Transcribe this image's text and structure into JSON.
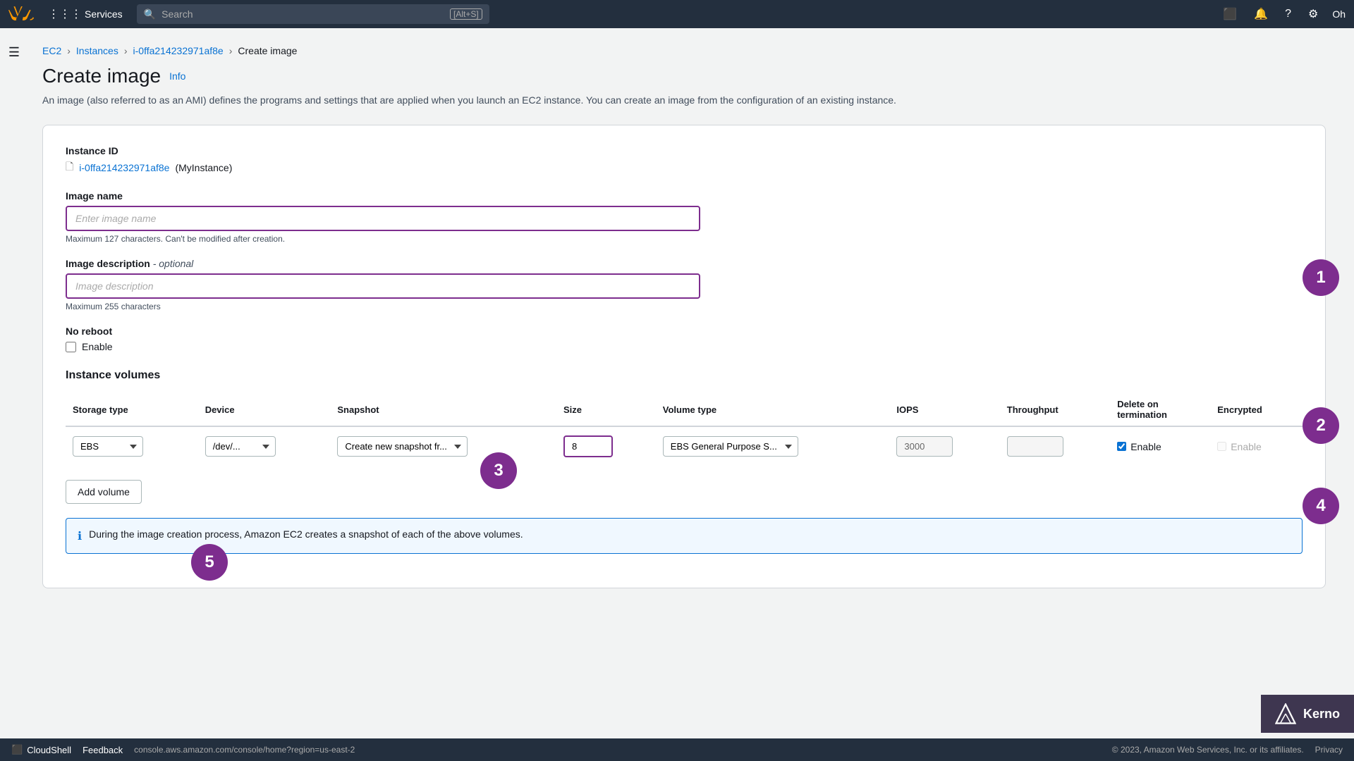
{
  "nav": {
    "aws_logo_alt": "AWS",
    "services_label": "Services",
    "search_placeholder": "Search",
    "search_shortcut": "[Alt+S]",
    "icon_terminal": "⬛",
    "icon_bell": "🔔",
    "icon_help": "?",
    "icon_settings": "⚙",
    "oh_label": "Oh"
  },
  "breadcrumb": {
    "ec2": "EC2",
    "instances": "Instances",
    "instance_id": "i-0ffa214232971af8e",
    "current": "Create image"
  },
  "page": {
    "title": "Create image",
    "info_link": "Info",
    "description": "An image (also referred to as an AMI) defines the programs and settings that are applied when you launch an EC2 instance. You can create an image from the configuration of an existing instance."
  },
  "form": {
    "instance_id_label": "Instance ID",
    "instance_id_value": "i-0ffa214232971af8e",
    "instance_id_suffix": "(MyInstance)",
    "image_name_label": "Image name",
    "image_name_placeholder": "Enter image name",
    "image_name_hint": "Maximum 127 characters. Can't be modified after creation.",
    "image_desc_label": "Image description",
    "image_desc_optional": "- optional",
    "image_desc_placeholder": "Image description",
    "image_desc_hint": "Maximum 255 characters",
    "no_reboot_label": "No reboot",
    "enable_label": "Enable",
    "volumes_title": "Instance volumes",
    "table_headers": [
      "Storage type",
      "Device",
      "Snapshot",
      "Size",
      "Volume type",
      "IOPS",
      "Throughput",
      "Delete on termination",
      "Encrypted"
    ],
    "volume_row": {
      "storage_type": "EBS",
      "device": "/dev/...",
      "snapshot": "Create new snapshot fr...",
      "size": "8",
      "volume_type": "EBS General Purpose S...",
      "iops": "3000",
      "throughput": "",
      "delete_on_term_checked": true,
      "delete_on_term_label": "Enable",
      "encrypted_checked": false,
      "encrypted_label": "Enable"
    },
    "add_volume_label": "Add volume",
    "info_banner_text": "During the image creation process, Amazon EC2 creates a snapshot of each of the above volumes."
  },
  "annotations": [
    "1",
    "2",
    "3",
    "4",
    "5"
  ],
  "bottom": {
    "cloudshell_label": "CloudShell",
    "feedback_label": "Feedback",
    "url": "console.aws.amazon.com/console/home?region=us-east-2",
    "copyright": "© 2023, Amazon Web Services, Inc. or its affiliates.",
    "privacy": "Privacy"
  },
  "kerno": {
    "label": "Kerno"
  }
}
